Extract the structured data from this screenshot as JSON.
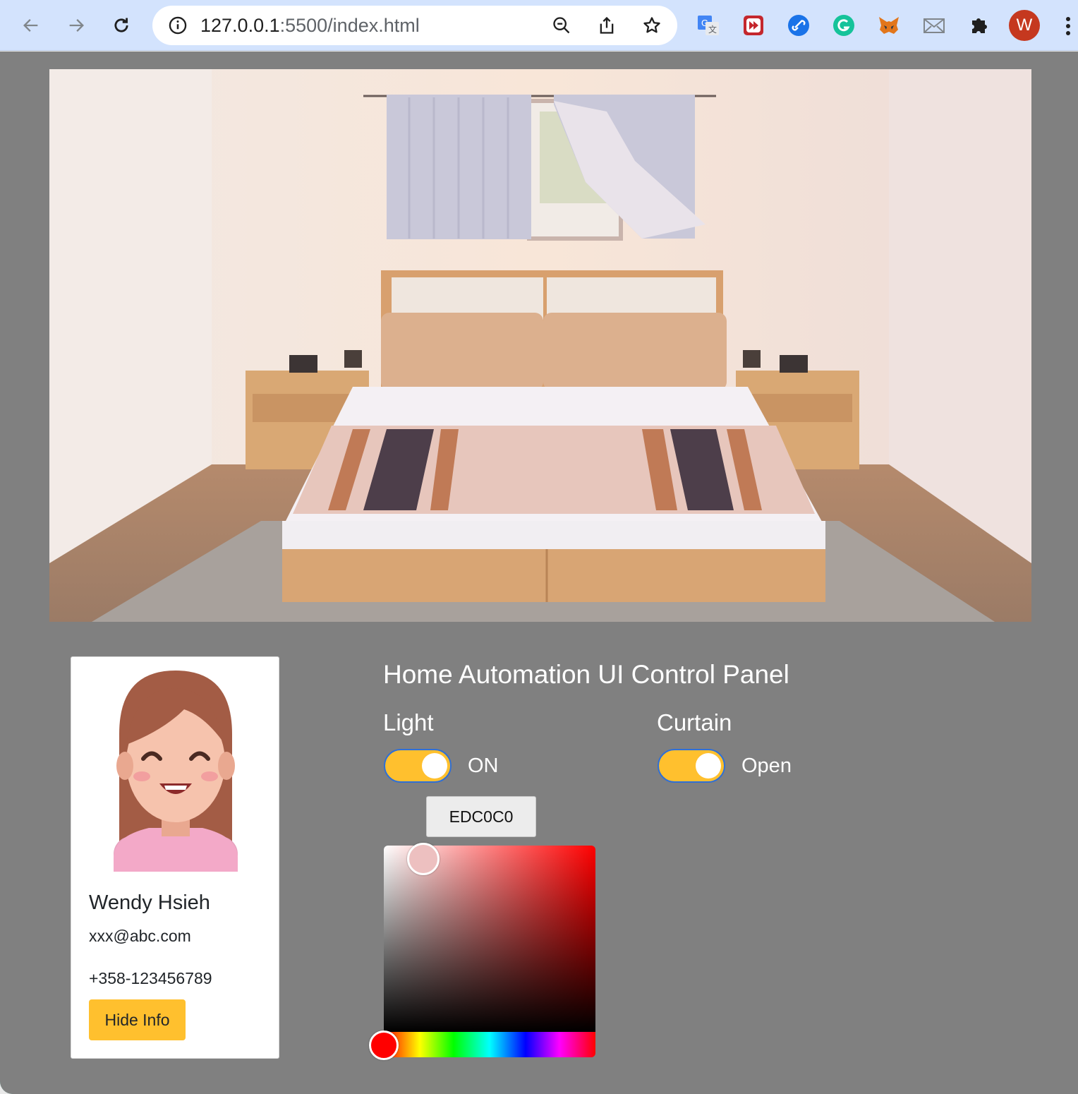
{
  "browser": {
    "url_host": "127.0.0.1",
    "url_rest": ":5500/index.html",
    "profile_initial": "W",
    "icons": [
      "back-arrow-icon",
      "forward-arrow-icon",
      "reload-icon",
      "site-info-icon",
      "zoom-icon",
      "share-icon",
      "bookmark-star-icon",
      "google-translate-icon",
      "extension-red-icon",
      "link-icon",
      "grammarly-icon",
      "metamask-fox-icon",
      "mail-icon",
      "puzzle-extensions-icon",
      "more-menu-icon"
    ]
  },
  "profile": {
    "name": "Wendy Hsieh",
    "email": "xxx@abc.com",
    "phone": "+358-123456789",
    "button": "Hide Info"
  },
  "panel": {
    "title": "Home Automation UI Control Panel",
    "light": {
      "label": "Light",
      "state": "ON"
    },
    "curtain": {
      "label": "Curtain",
      "state": "Open"
    },
    "color_hex": "EDC0C0"
  },
  "colors": {
    "accent": "#ffc02e",
    "background": "#808080",
    "selected_color": "#edc0c0",
    "toggle_border": "#2f6fd6"
  }
}
